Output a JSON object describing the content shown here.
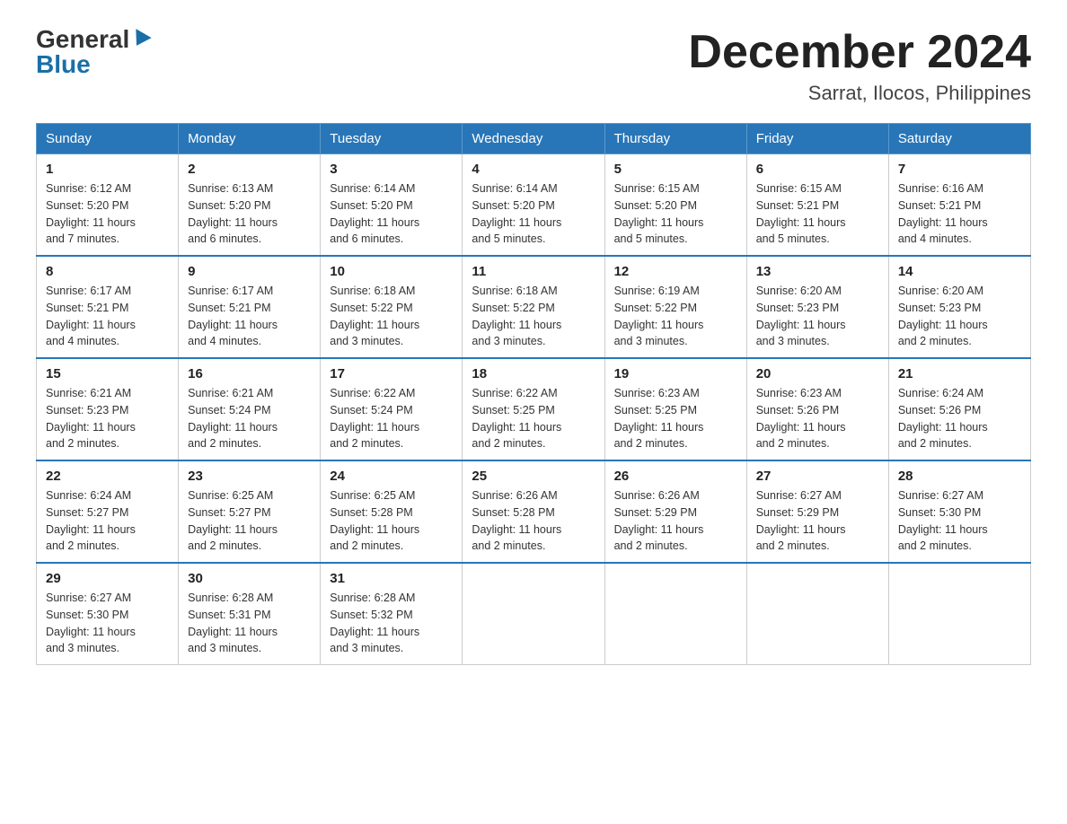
{
  "header": {
    "logo_general": "General",
    "logo_blue": "Blue",
    "month_year": "December 2024",
    "location": "Sarrat, Ilocos, Philippines"
  },
  "weekdays": [
    "Sunday",
    "Monday",
    "Tuesday",
    "Wednesday",
    "Thursday",
    "Friday",
    "Saturday"
  ],
  "weeks": [
    [
      {
        "day": "1",
        "sunrise": "6:12 AM",
        "sunset": "5:20 PM",
        "daylight": "11 hours and 7 minutes."
      },
      {
        "day": "2",
        "sunrise": "6:13 AM",
        "sunset": "5:20 PM",
        "daylight": "11 hours and 6 minutes."
      },
      {
        "day": "3",
        "sunrise": "6:14 AM",
        "sunset": "5:20 PM",
        "daylight": "11 hours and 6 minutes."
      },
      {
        "day": "4",
        "sunrise": "6:14 AM",
        "sunset": "5:20 PM",
        "daylight": "11 hours and 5 minutes."
      },
      {
        "day": "5",
        "sunrise": "6:15 AM",
        "sunset": "5:20 PM",
        "daylight": "11 hours and 5 minutes."
      },
      {
        "day": "6",
        "sunrise": "6:15 AM",
        "sunset": "5:21 PM",
        "daylight": "11 hours and 5 minutes."
      },
      {
        "day": "7",
        "sunrise": "6:16 AM",
        "sunset": "5:21 PM",
        "daylight": "11 hours and 4 minutes."
      }
    ],
    [
      {
        "day": "8",
        "sunrise": "6:17 AM",
        "sunset": "5:21 PM",
        "daylight": "11 hours and 4 minutes."
      },
      {
        "day": "9",
        "sunrise": "6:17 AM",
        "sunset": "5:21 PM",
        "daylight": "11 hours and 4 minutes."
      },
      {
        "day": "10",
        "sunrise": "6:18 AM",
        "sunset": "5:22 PM",
        "daylight": "11 hours and 3 minutes."
      },
      {
        "day": "11",
        "sunrise": "6:18 AM",
        "sunset": "5:22 PM",
        "daylight": "11 hours and 3 minutes."
      },
      {
        "day": "12",
        "sunrise": "6:19 AM",
        "sunset": "5:22 PM",
        "daylight": "11 hours and 3 minutes."
      },
      {
        "day": "13",
        "sunrise": "6:20 AM",
        "sunset": "5:23 PM",
        "daylight": "11 hours and 3 minutes."
      },
      {
        "day": "14",
        "sunrise": "6:20 AM",
        "sunset": "5:23 PM",
        "daylight": "11 hours and 2 minutes."
      }
    ],
    [
      {
        "day": "15",
        "sunrise": "6:21 AM",
        "sunset": "5:23 PM",
        "daylight": "11 hours and 2 minutes."
      },
      {
        "day": "16",
        "sunrise": "6:21 AM",
        "sunset": "5:24 PM",
        "daylight": "11 hours and 2 minutes."
      },
      {
        "day": "17",
        "sunrise": "6:22 AM",
        "sunset": "5:24 PM",
        "daylight": "11 hours and 2 minutes."
      },
      {
        "day": "18",
        "sunrise": "6:22 AM",
        "sunset": "5:25 PM",
        "daylight": "11 hours and 2 minutes."
      },
      {
        "day": "19",
        "sunrise": "6:23 AM",
        "sunset": "5:25 PM",
        "daylight": "11 hours and 2 minutes."
      },
      {
        "day": "20",
        "sunrise": "6:23 AM",
        "sunset": "5:26 PM",
        "daylight": "11 hours and 2 minutes."
      },
      {
        "day": "21",
        "sunrise": "6:24 AM",
        "sunset": "5:26 PM",
        "daylight": "11 hours and 2 minutes."
      }
    ],
    [
      {
        "day": "22",
        "sunrise": "6:24 AM",
        "sunset": "5:27 PM",
        "daylight": "11 hours and 2 minutes."
      },
      {
        "day": "23",
        "sunrise": "6:25 AM",
        "sunset": "5:27 PM",
        "daylight": "11 hours and 2 minutes."
      },
      {
        "day": "24",
        "sunrise": "6:25 AM",
        "sunset": "5:28 PM",
        "daylight": "11 hours and 2 minutes."
      },
      {
        "day": "25",
        "sunrise": "6:26 AM",
        "sunset": "5:28 PM",
        "daylight": "11 hours and 2 minutes."
      },
      {
        "day": "26",
        "sunrise": "6:26 AM",
        "sunset": "5:29 PM",
        "daylight": "11 hours and 2 minutes."
      },
      {
        "day": "27",
        "sunrise": "6:27 AM",
        "sunset": "5:29 PM",
        "daylight": "11 hours and 2 minutes."
      },
      {
        "day": "28",
        "sunrise": "6:27 AM",
        "sunset": "5:30 PM",
        "daylight": "11 hours and 2 minutes."
      }
    ],
    [
      {
        "day": "29",
        "sunrise": "6:27 AM",
        "sunset": "5:30 PM",
        "daylight": "11 hours and 3 minutes."
      },
      {
        "day": "30",
        "sunrise": "6:28 AM",
        "sunset": "5:31 PM",
        "daylight": "11 hours and 3 minutes."
      },
      {
        "day": "31",
        "sunrise": "6:28 AM",
        "sunset": "5:32 PM",
        "daylight": "11 hours and 3 minutes."
      },
      null,
      null,
      null,
      null
    ]
  ],
  "labels": {
    "sunrise": "Sunrise:",
    "sunset": "Sunset:",
    "daylight": "Daylight:"
  }
}
